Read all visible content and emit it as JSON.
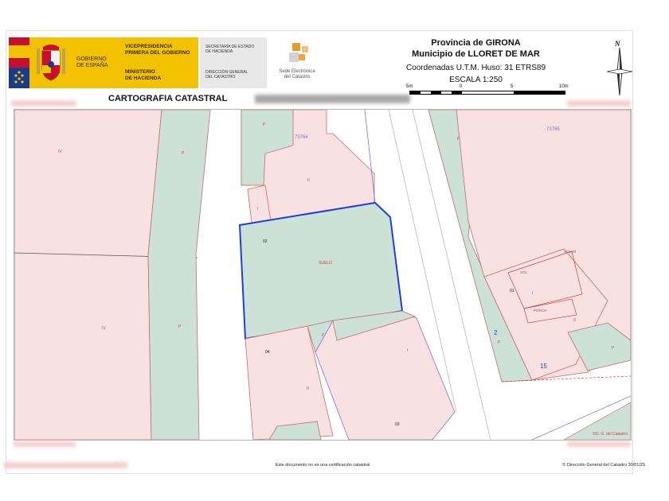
{
  "header": {
    "gov_left": [
      "GOBIERNO",
      "DE ESPAÑA"
    ],
    "gov_right_1": [
      "VICEPRESIDENCIA",
      "PRIMERA DEL GOBIERNO"
    ],
    "gov_right_2": [
      "MINISTERIO",
      "DE HACIENDA"
    ],
    "grey_1": [
      "SECRETARÍA DE ESTADO",
      "DE HACIENDA"
    ],
    "grey_2": [
      "DIRECCIÓN GENERAL",
      "DEL CATASTRO"
    ],
    "sede": [
      "Sede Electrónica",
      "del Catastro"
    ],
    "provincia": "Provincia de GIRONA",
    "municipio": "Municipio de LLORET DE MAR",
    "coordenadas": "Coordenadas U.T.M. Huso: 31 ETRS89",
    "escala": "ESCALA 1:250",
    "scale_labels": [
      "5m",
      "0",
      "5",
      "10m"
    ],
    "north": "N",
    "title": "CARTOGRAFIA CATASTRAL"
  },
  "map": {
    "labels": {
      "l1": "IV",
      "l2": "P",
      "l3": "IV",
      "l4": "P",
      "parcel_a": "73764",
      "parcel_b": "73765",
      "p1": "P",
      "p2": "II",
      "p3": "I",
      "p4": "02",
      "p5": "SUELO",
      "p6": "04",
      "p7": "II",
      "p8": "P",
      "p9": "I",
      "p10": "03",
      "r1": "P",
      "r2": "I",
      "r3": "01",
      "r4": "SOLAR",
      "r5": "PORCH",
      "r6": "II",
      "r7": "SOL",
      "r8": "P",
      "r9": "2",
      "r10": "15",
      "r11": "P"
    },
    "copyright": "©D. G. del Catastro"
  },
  "footer": {
    "note": "Este documento no es una certificación catastral",
    "copy": "© Dirección General del Catastro 30/01/25"
  }
}
